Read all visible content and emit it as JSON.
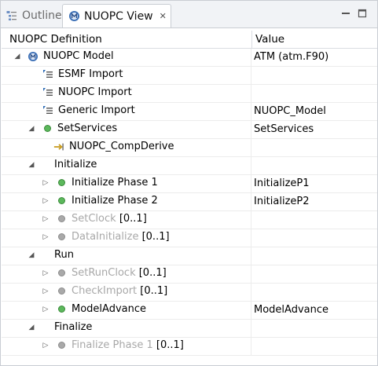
{
  "tabs": [
    {
      "label": "Outline",
      "icon": "outline-icon"
    },
    {
      "label": "NUOPC View",
      "icon": "nuopc-view-icon",
      "active": true
    }
  ],
  "columns": {
    "definition": "NUOPC Definition",
    "value": "Value"
  },
  "rows": [
    {
      "label": "NUOPC Model",
      "value": "ATM (atm.F90)",
      "icon": "model-icon",
      "toggle": "expanded"
    },
    {
      "label": "ESMF Import",
      "value": "",
      "icon": "import-icon"
    },
    {
      "label": "NUOPC Import",
      "value": "",
      "icon": "import-icon"
    },
    {
      "label": "Generic Import",
      "value": "NUOPC_Model",
      "icon": "import-icon"
    },
    {
      "label": "SetServices",
      "value": "SetServices",
      "icon": "green-dot-icon",
      "toggle": "expanded"
    },
    {
      "label": "NUOPC_CompDerive",
      "value": "",
      "icon": "derive-arrow-icon"
    },
    {
      "label": "Initialize",
      "value": "",
      "toggle": "expanded"
    },
    {
      "label": "Initialize Phase 1",
      "value": "InitializeP1",
      "icon": "green-dot-icon",
      "toggle": "collapsed"
    },
    {
      "label": "Initialize Phase 2",
      "value": "InitializeP2",
      "icon": "green-dot-icon",
      "toggle": "collapsed"
    },
    {
      "label": "SetClock",
      "suffix": "[0..1]",
      "value": "",
      "icon": "gray-dot-icon",
      "toggle": "collapsed",
      "dim": true
    },
    {
      "label": "DataInitialize",
      "suffix": "[0..1]",
      "value": "",
      "icon": "gray-dot-icon",
      "toggle": "collapsed",
      "dim": true
    },
    {
      "label": "Run",
      "value": "",
      "toggle": "expanded"
    },
    {
      "label": "SetRunClock",
      "suffix": "[0..1]",
      "value": "",
      "icon": "gray-dot-icon",
      "toggle": "collapsed",
      "dim": true
    },
    {
      "label": "CheckImport",
      "suffix": "[0..1]",
      "value": "",
      "icon": "gray-dot-icon",
      "toggle": "collapsed",
      "dim": true
    },
    {
      "label": "ModelAdvance",
      "value": "ModelAdvance",
      "icon": "green-dot-icon",
      "toggle": "collapsed"
    },
    {
      "label": "Finalize",
      "value": "",
      "toggle": "expanded"
    },
    {
      "label": "Finalize Phase 1",
      "suffix": "[0..1]",
      "value": "",
      "icon": "gray-dot-icon",
      "toggle": "collapsed",
      "dim": true
    }
  ]
}
